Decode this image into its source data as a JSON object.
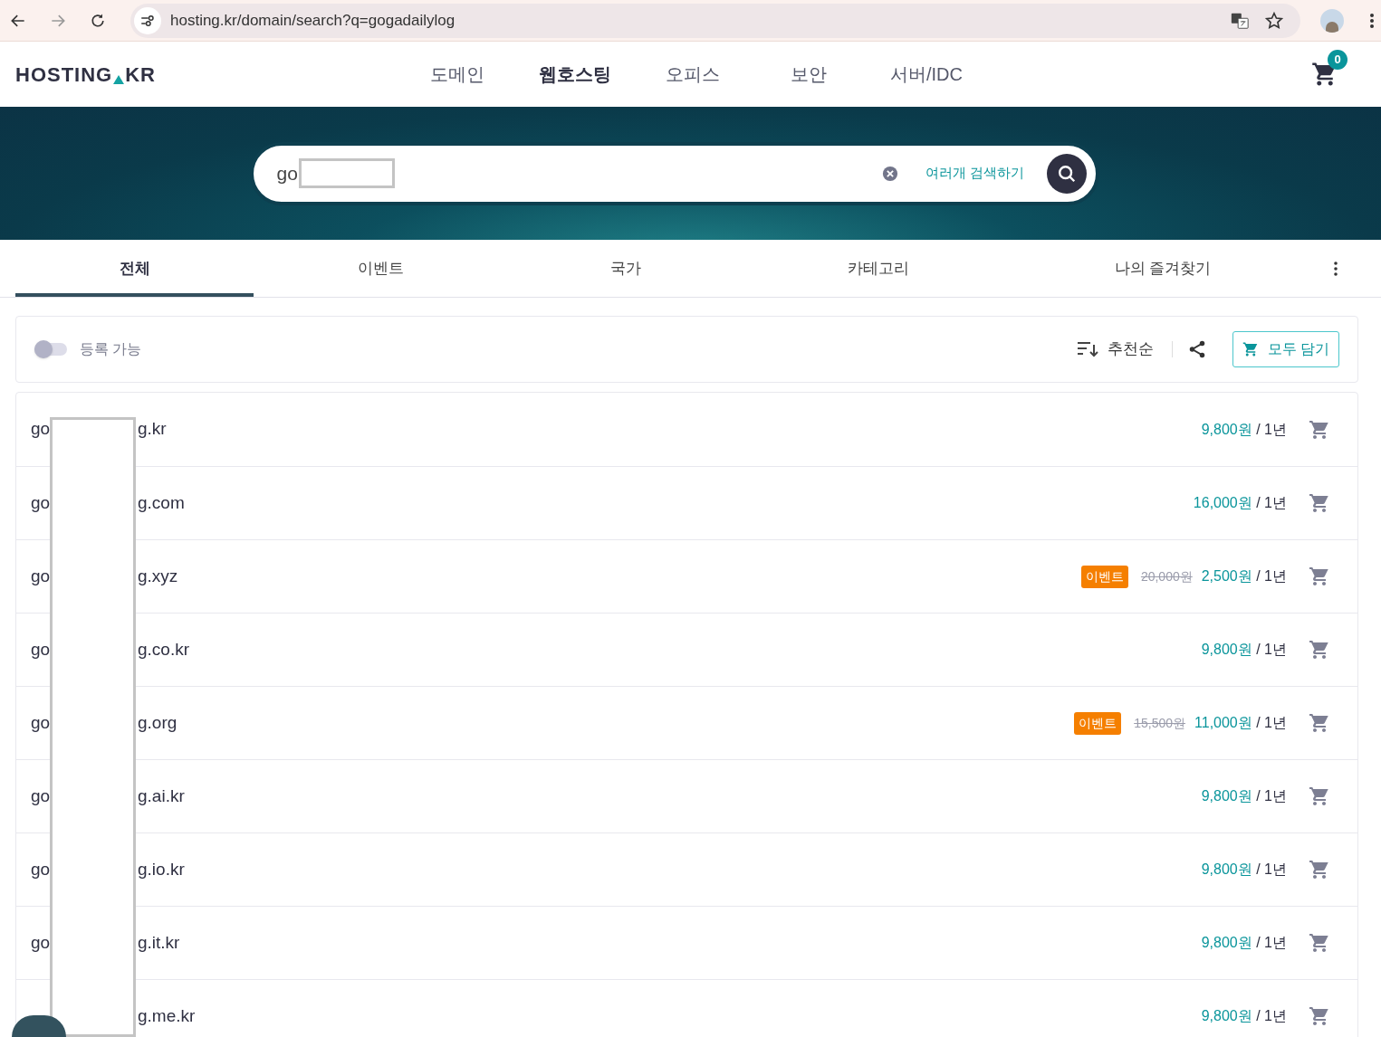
{
  "browser": {
    "url": "hosting.kr/domain/search?q=gogadailylog"
  },
  "header": {
    "logo_left": "HOSTING",
    "logo_right": "KR",
    "nav": [
      {
        "label": "도메인",
        "selected": false
      },
      {
        "label": "웹호스팅",
        "selected": true
      },
      {
        "label": "오피스",
        "selected": false
      },
      {
        "label": "보안",
        "selected": false
      },
      {
        "label": "서버/IDC",
        "selected": false
      }
    ],
    "cart_count": "0"
  },
  "search": {
    "value": "go",
    "multi_search": "여러개 검색하기"
  },
  "tabs": [
    {
      "label": "전체",
      "selected": true
    },
    {
      "label": "이벤트",
      "selected": false
    },
    {
      "label": "국가",
      "selected": false
    },
    {
      "label": "카테고리",
      "selected": false
    },
    {
      "label": "나의 즐겨찾기",
      "selected": false
    }
  ],
  "filter": {
    "available_toggle": {
      "label": "등록 가능",
      "on": false
    },
    "sort": "추천순",
    "add_all": "모두 담기"
  },
  "results": [
    {
      "prefix": "go",
      "suffix": "g.kr",
      "price": "9,800원",
      "period": " / 1년"
    },
    {
      "prefix": "go",
      "suffix": "g.com",
      "price": "16,000원",
      "period": " / 1년"
    },
    {
      "prefix": "go",
      "suffix": "g.xyz",
      "badge": "이벤트",
      "old_price": "20,000원",
      "price": "2,500원",
      "period": " / 1년"
    },
    {
      "prefix": "go",
      "suffix": "g.co.kr",
      "price": "9,800원",
      "period": " / 1년"
    },
    {
      "prefix": "go",
      "suffix": "g.org",
      "badge": "이벤트",
      "old_price": "15,500원",
      "price": "11,000원",
      "period": " / 1년"
    },
    {
      "prefix": "go",
      "suffix": "g.ai.kr",
      "price": "9,800원",
      "period": " / 1년"
    },
    {
      "prefix": "go",
      "suffix": "g.io.kr",
      "price": "9,800원",
      "period": " / 1년"
    },
    {
      "prefix": "go",
      "suffix": "g.it.kr",
      "price": "9,800원",
      "period": " / 1년"
    },
    {
      "suffix": "g.me.kr",
      "price": "9,800원",
      "period": " / 1년"
    }
  ]
}
